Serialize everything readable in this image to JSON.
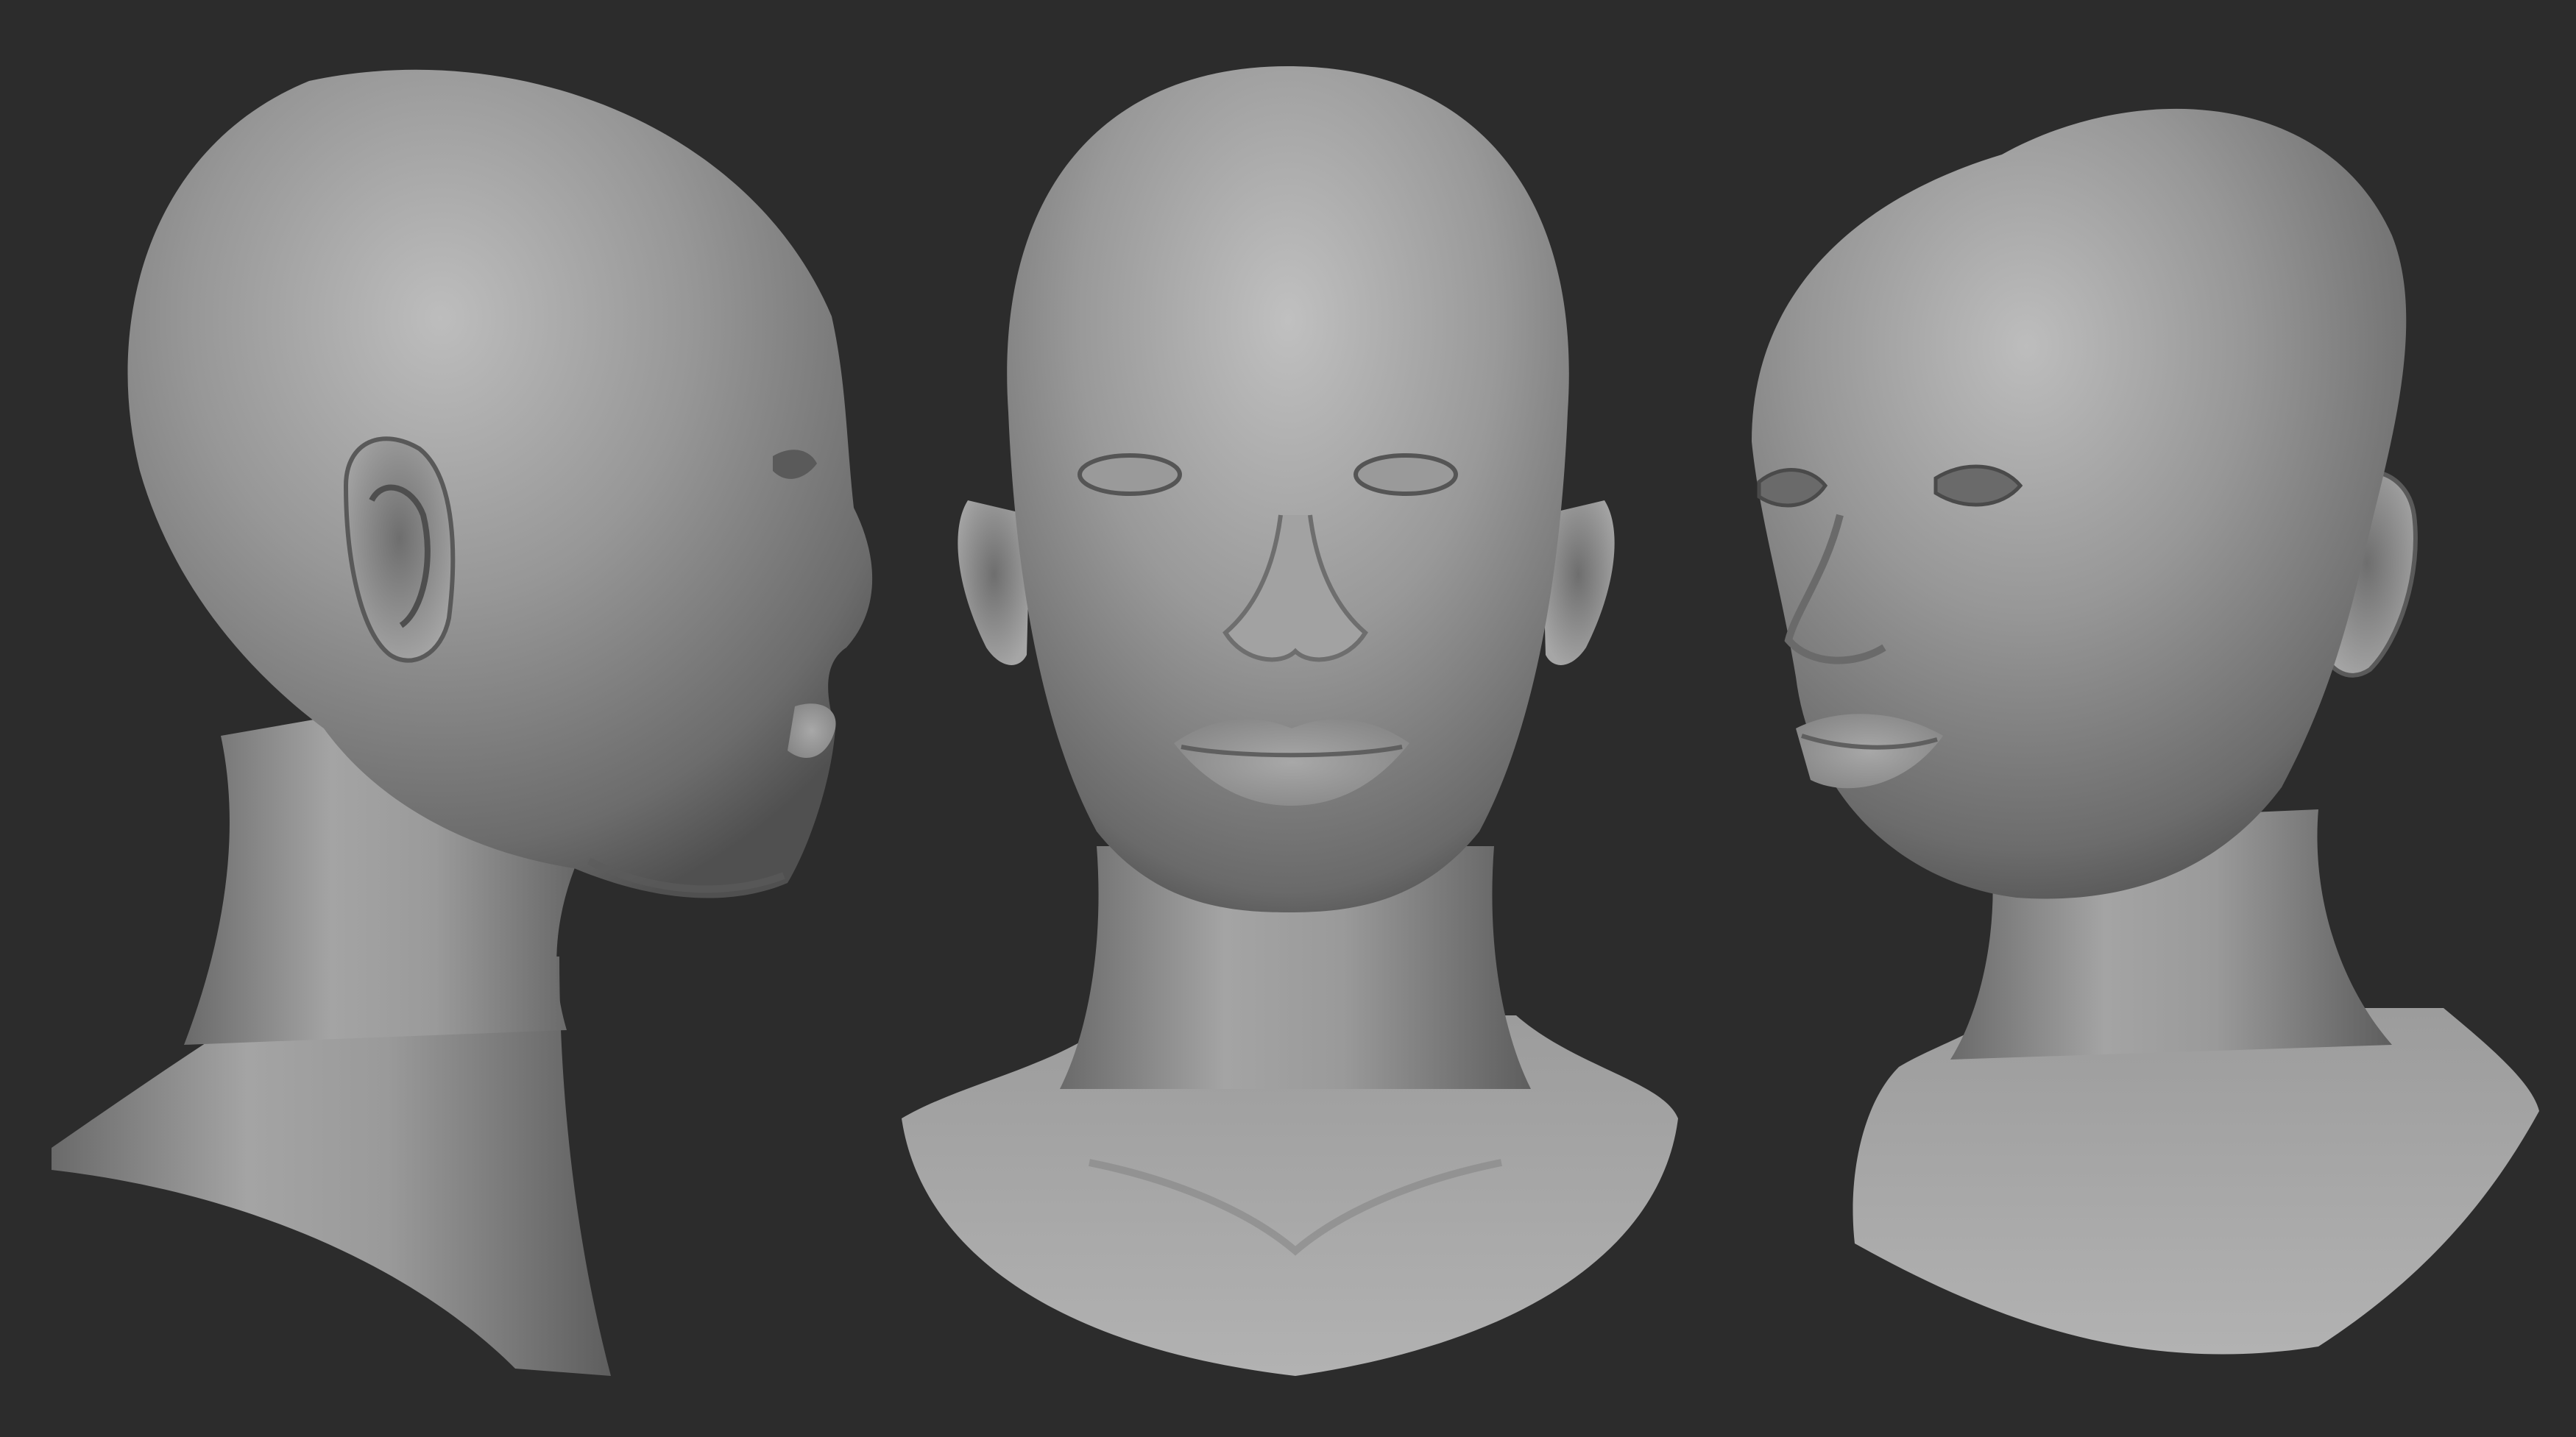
{
  "colors": {
    "background": "#2c2c2c",
    "skin_highlight": "#b9b9b9",
    "skin_mid": "#8c8c8c",
    "skin_shadow": "#4a4a4a",
    "detail_line": "#3a3a3a"
  },
  "views": [
    {
      "name": "head-profile-view",
      "angle": "left profile"
    },
    {
      "name": "head-front-view",
      "angle": "front"
    },
    {
      "name": "head-three-quarter-view",
      "angle": "three-quarter"
    }
  ]
}
